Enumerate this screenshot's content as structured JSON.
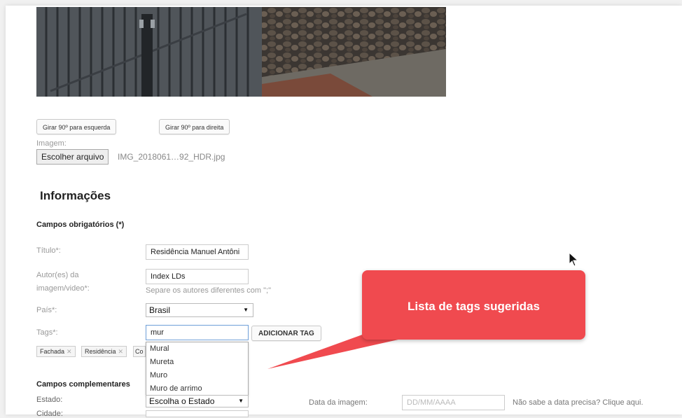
{
  "photo": {
    "alt": "Fotografia da fachada"
  },
  "rotate": {
    "left_label": "Girar 90º para esquerda",
    "right_label": "Girar 90º para direita"
  },
  "image_field": {
    "label": "Imagem:",
    "choose_button": "Escolher arquivo",
    "file_name": "IMG_2018061…92_HDR.jpg"
  },
  "section_title": "Informações",
  "required_title": "Campos obrigatórios (*)",
  "fields": {
    "title": {
      "label": "Título*:",
      "value": "Residência Manuel Antôni"
    },
    "author": {
      "label_line1": "Autor(es) da",
      "label_line2": "imagem/video*:",
      "value": "Index LDs",
      "hint": "Separe os autores diferentes com \";\""
    },
    "country": {
      "label": "País*:",
      "value": "Brasil"
    },
    "tags": {
      "label": "Tags*:",
      "value": "mur",
      "add_button": "ADICIONAR TAG",
      "chips": [
        "Fachada",
        "Residência",
        "Co"
      ],
      "suggestions": [
        "Mural",
        "Mureta",
        "Muro",
        "Muro de arrimo"
      ]
    }
  },
  "complementary_title": "Campos complementares",
  "state": {
    "label": "Estado:",
    "value": "Escolha o Estado"
  },
  "city": {
    "label": "Cidade:"
  },
  "image_date": {
    "label": "Data da imagem:",
    "placeholder": "DD/MM/AAAA",
    "help_link": "Não sabe a data precisa? Clique aqui."
  },
  "callout": {
    "text": "Lista de tags sugeridas",
    "color": "#f04a4f"
  },
  "colors": {
    "page_bg": "#ffffff",
    "outer_bg": "#f1f1f1"
  }
}
